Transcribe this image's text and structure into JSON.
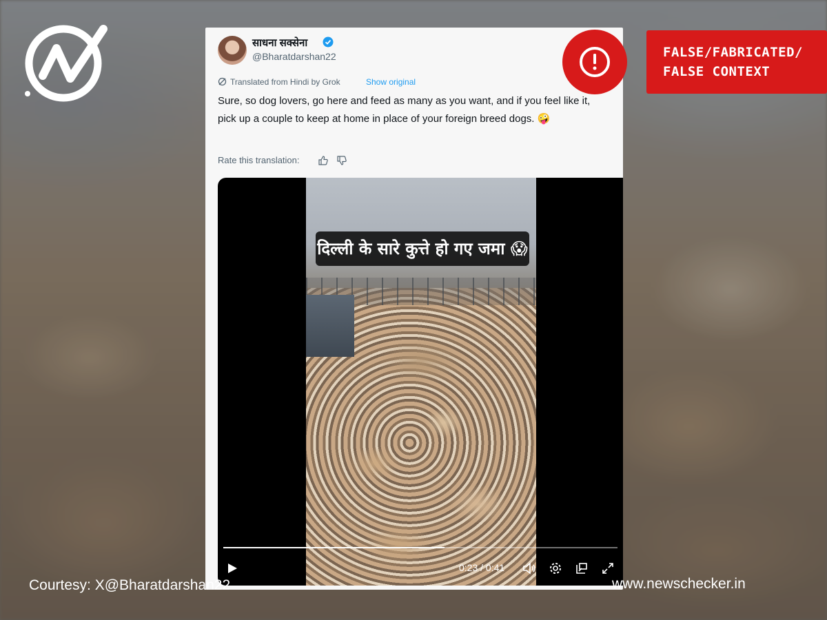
{
  "branding": {
    "logo_icon": "newschecker-check-icon",
    "courtesy_text": "Courtesy: X@Bharatdarshan22",
    "site_url": "www.newschecker.in"
  },
  "verdict": {
    "icon": "exclamation-circle-icon",
    "lines": [
      "FALSE/FABRICATED/",
      "FALSE CONTEXT"
    ],
    "color": "#d71a1a"
  },
  "tweet": {
    "author_name": "साधना सक्सेना",
    "handle": "@Bharatdarshan22",
    "verified": true,
    "translated_label": "Translated from Hindi by Grok",
    "show_original_label": "Show original",
    "text": "Sure, so dog lovers, go here and feed as many as you want, and if you feel like it, pick up a couple to keep at home in place of your foreign breed dogs. 🤪",
    "rate_label": "Rate this translation:",
    "link_color": "#1d9bf0"
  },
  "video": {
    "caption": "दिल्ली के सारे कुत्ते हो गए जमा 😱",
    "time_display": "0:23 / 0:41",
    "progress": 0.561
  }
}
